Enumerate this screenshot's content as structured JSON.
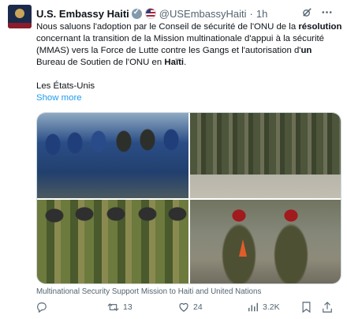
{
  "tweet": {
    "author_name": "U.S. Embassy Haiti",
    "handle": "@USEmbassyHaiti",
    "separator": "·",
    "time": "1h",
    "body": [
      {
        "text": "Nous saluons l'adoption par le Conseil de sécurité de l'ONU de la ",
        "bold": false
      },
      {
        "text": "résolution",
        "bold": true
      },
      {
        "text": " concernant la transition de la Mission multinationale d'appui à la sécurité (MMAS) vers la Force de Lutte contre les Gangs et l'autorisation d'",
        "bold": false
      },
      {
        "text": "un",
        "bold": true
      },
      {
        "text": " Bureau de Soutien de l'ONU en ",
        "bold": false
      },
      {
        "text": "Haïti",
        "bold": true
      },
      {
        "text": ".",
        "bold": false
      }
    ],
    "body_line2": "Les États-Unis",
    "show_more": "Show more",
    "media_caption": "Multinational Security Support Mission to Haiti and United Nations",
    "actions": {
      "reply_count": "",
      "retweet_count": "13",
      "like_count": "24",
      "views_count": "3.2K"
    }
  },
  "icons": [
    "avatar-logo",
    "verified-badge-icon",
    "us-flag-icon",
    "grok-icon",
    "more-icon",
    "reply-icon",
    "retweet-icon",
    "like-icon",
    "views-icon",
    "bookmark-icon",
    "share-icon"
  ],
  "colors": {
    "link": "#1d9bf0",
    "secondary_text": "#536471",
    "primary_text": "#0f1419"
  }
}
